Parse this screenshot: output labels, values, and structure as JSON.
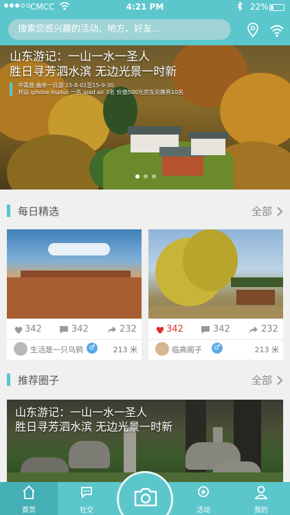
{
  "status_bar": {
    "carrier": "CMCC",
    "time": "4:21 PM",
    "battery": "22%"
  },
  "search": {
    "placeholder": "搜索您感兴趣的活动、地方、好友..."
  },
  "banner": {
    "title_line1": "山东游记：一山一水一圣人",
    "title_line2": "胜日寻芳泗水滨  无边光景一时新",
    "sub_line1": "中青旅 曲阜一日游   15-8-01至15-9-30",
    "sub_line2": "共设 iphone 6splus 一名  ipad air 3名   价值500元京东兑换券10名",
    "slide_count": 3,
    "active_slide": 1
  },
  "daily": {
    "title": "每日精选",
    "more": "全部"
  },
  "cards": [
    {
      "likes": "342",
      "comments": "342",
      "shares": "232",
      "author": "生活是一只乌鸦",
      "distance": "213 米",
      "liked": false
    },
    {
      "likes": "342",
      "comments": "342",
      "shares": "232",
      "author": "临高阁子",
      "distance": "213 米",
      "liked": true
    }
  ],
  "circles": {
    "title": "推荐圈子",
    "more": "全部",
    "banner_line1": "山东游记：一山一水一圣人",
    "banner_line2": "胜日寻芳泗水滨  无边光景一时新"
  },
  "tabs": [
    {
      "label": "首页",
      "icon": "home-icon"
    },
    {
      "label": "社交",
      "icon": "chat-icon"
    },
    {
      "label": "活动",
      "icon": "badge-icon"
    },
    {
      "label": "我的",
      "icon": "person-icon"
    }
  ],
  "colors": {
    "accent": "#5bc6cc",
    "like_red": "#d9302c"
  }
}
